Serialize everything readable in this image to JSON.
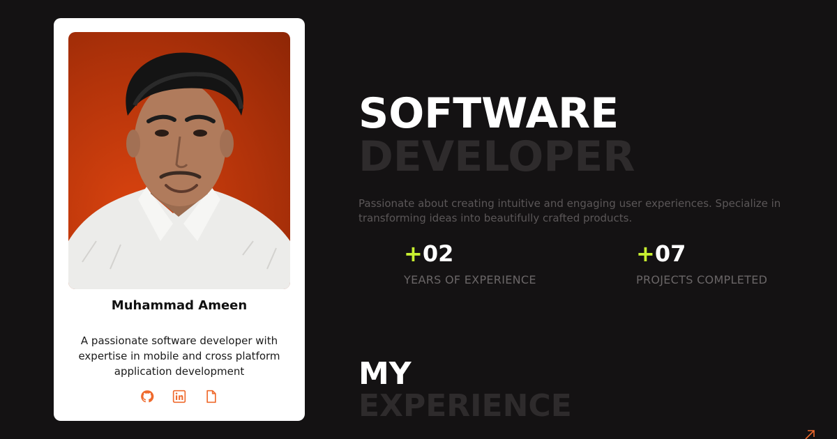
{
  "profile": {
    "name": "Muhammad Ameen",
    "bio": "A passionate software developer with expertise in mobile and cross platform application development",
    "social_icons": [
      "github-icon",
      "linkedin-icon",
      "document-icon"
    ],
    "icon_color": "#ef6a2d"
  },
  "hero": {
    "title_line1": "SOFTWARE",
    "title_line2": "DEVELOPER",
    "description": "Passionate about creating intuitive and engaging user experiences. Specialize in transforming ideas into beautifully crafted products."
  },
  "stats": [
    {
      "prefix": "+",
      "value": "02",
      "label": "YEARS OF EXPERIENCE"
    },
    {
      "prefix": "+",
      "value": "07",
      "label": "PROJECTS COMPLETED"
    }
  ],
  "experience": {
    "title_line1": "MY",
    "title_line2": "EXPERIENCE",
    "arrow_icon": "arrow-up-right-icon"
  },
  "colors": {
    "background": "#141213",
    "accent": "#c8f031",
    "photo_background": "#c23a0c",
    "muted_heading": "#2e2b2c"
  }
}
